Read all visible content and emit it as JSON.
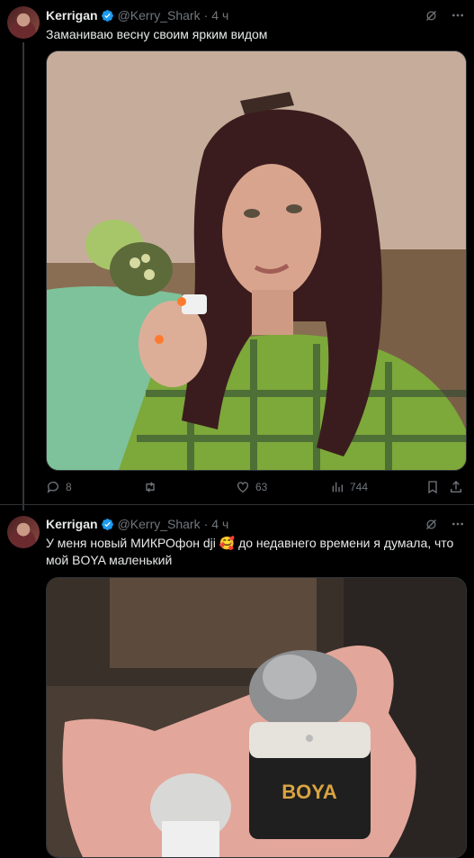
{
  "tweets": [
    {
      "author": "Kerrigan",
      "handle": "@Kerry_Shark",
      "time": "4 ч",
      "text": "Заманиваю весну своим ярким видом",
      "replies": "8",
      "retweets": "",
      "likes": "63",
      "views": "744"
    },
    {
      "author": "Kerrigan",
      "handle": "@Kerry_Shark",
      "time": "4 ч",
      "text_part1": "У меня новый МИКРОфон dji ",
      "emoji": "🥰",
      "text_part2": " до недавнего времени я думала, что мой BOYA маленький",
      "brand": "BOYA"
    }
  ],
  "sep": "·"
}
